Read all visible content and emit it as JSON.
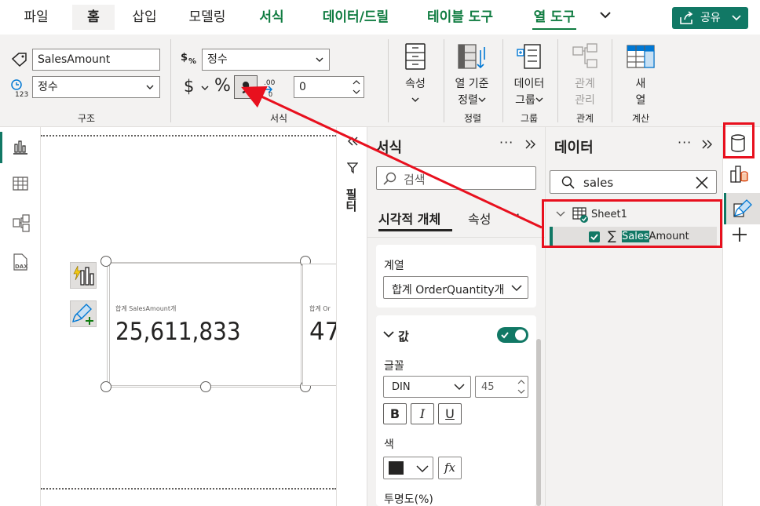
{
  "tabs": [
    "파일",
    "홈",
    "삽입",
    "모델링",
    "서식",
    "데이터/드릴",
    "테이블 도구",
    "열 도구"
  ],
  "share_label": "공유",
  "ribbon": {
    "name_value": "SalesAmount",
    "datatype_value": "정수",
    "format_value": "정수",
    "currency_symbol": "$",
    "percent_symbol": "%",
    "comma_symbol": "❟",
    "decimal_symbol": ".00",
    "decimal_places": "0",
    "group_structure": "구조",
    "group_format": "서식",
    "properties_line1": "속성",
    "sortby_line1": "열 기준",
    "sortby_line2": "정렬",
    "sort_group_label": "정렬",
    "datagroup_line1": "데이터",
    "datagroup_line2": "그룹",
    "group_group_label": "그룹",
    "rel_line1": "관계",
    "rel_line2": "관리",
    "rel_group_label": "관계",
    "newcol_line1": "새",
    "newcol_line2": "열",
    "calc_group_label": "계산"
  },
  "canvas": {
    "card1_label": "합계 SalesAmount개",
    "card1_value": "25,611,833",
    "card2_label": "합계 Or",
    "card2_value": "47"
  },
  "filter_label": "필터",
  "format_pane": {
    "title": "서식",
    "search_placeholder": "검색",
    "tab_visual": "시각적 개체",
    "tab_general": "속성",
    "series_label": "계열",
    "series_value": "합계 OrderQuantity개",
    "values_header": "값",
    "font_label": "글꼴",
    "font_family": "DIN",
    "font_size": "45",
    "bold_label": "B",
    "italic_label": "I",
    "underline_label": "U",
    "color_label": "색",
    "color_swatch": "#252423",
    "fx_label": "fx",
    "transparency_label": "투명도(%)"
  },
  "data_pane": {
    "title": "데이터",
    "search_value": "sales",
    "table_name": "Sheet1",
    "field_highlight": "Sales",
    "field_rest": "Amount"
  },
  "colors": {
    "accent": "#107c41",
    "highlight_box": "#e8101e",
    "share_bg": "#117865"
  }
}
